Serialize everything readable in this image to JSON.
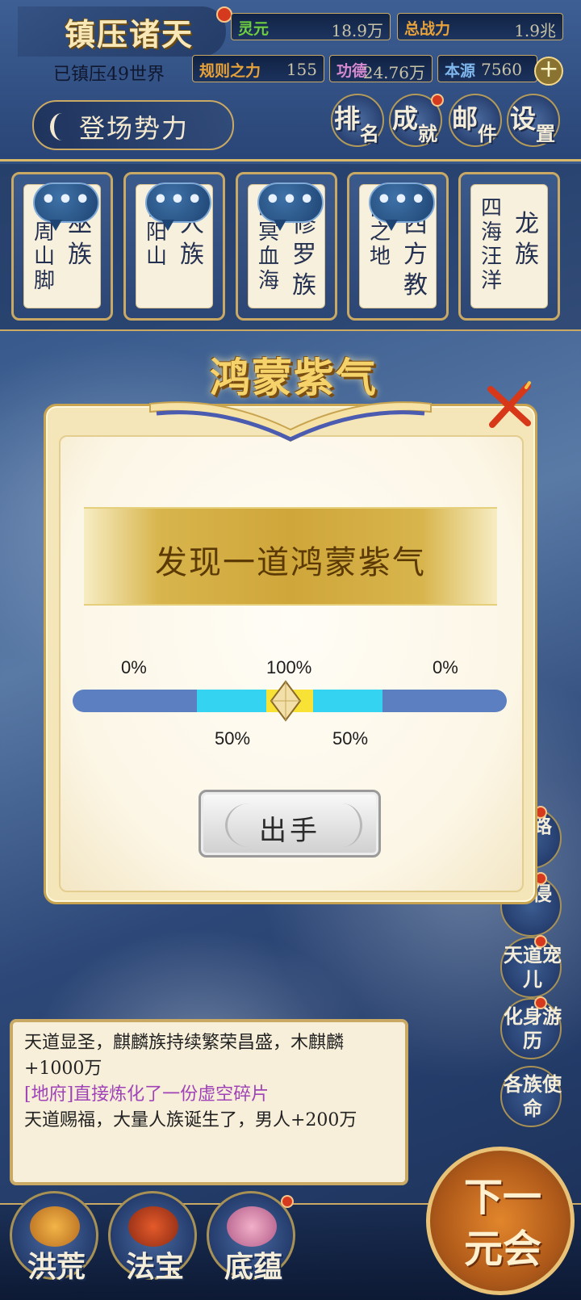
{
  "header": {
    "title": "镇压诸天",
    "suppressed_worlds": "已镇压49世界",
    "faction_button": "登场势力",
    "resources": [
      {
        "label": "灵元",
        "value": "18.9万"
      },
      {
        "label": "总战力",
        "value": "1.9兆"
      },
      {
        "label": "规则之力",
        "value": "155"
      },
      {
        "label": "功德",
        "value": "24.76万"
      },
      {
        "label": "本源",
        "value": "7560"
      }
    ],
    "menu": [
      {
        "c1": "排",
        "c2": "名"
      },
      {
        "c1": "成",
        "c2": "就"
      },
      {
        "c1": "邮",
        "c2": "件"
      },
      {
        "c1": "设",
        "c2": "置"
      }
    ]
  },
  "factions": [
    {
      "place": "不周山脚",
      "race": "巫族",
      "chat": "•••"
    },
    {
      "place": "首阳山",
      "race": "人族",
      "chat": "•••"
    },
    {
      "place": "幽冥血海",
      "race": "修罗族",
      "chat": "•••"
    },
    {
      "place": "西之地",
      "race": "西方教",
      "chat": "•••"
    },
    {
      "place": "四海汪洋",
      "race": "龙族",
      "chat": ""
    }
  ],
  "modal": {
    "title": "鸿蒙紫气",
    "message": "发现一道鸿蒙紫气",
    "pct_left": "0%",
    "pct_center": "100%",
    "pct_right": "0%",
    "pct_mid_left": "50%",
    "pct_mid_right": "50%",
    "button": "出手"
  },
  "side_menu": [
    {
      "label": "道路"
    },
    {
      "label": "域侵"
    },
    {
      "label": "天道宠儿"
    },
    {
      "label": "化身游历"
    },
    {
      "label": "各族使命"
    }
  ],
  "log": {
    "line1": "天道显圣，麒麟族持续繁荣昌盛，木麒麟+1000万",
    "line2": "[地府]直接炼化了一份虚空碎片",
    "line3": "天道赐福，大量人族诞生了，男人+200万"
  },
  "bottom": {
    "btn1": "洪荒",
    "btn2": "法宝",
    "btn3": "底蕴",
    "next": "下一元会"
  },
  "colors": {
    "accent_gold": "#c9a963",
    "bar_blue": "#5b7fc0",
    "bar_cyan": "#35d3f2",
    "bar_yellow": "#f7e235",
    "notify_red": "#d63a1e"
  }
}
